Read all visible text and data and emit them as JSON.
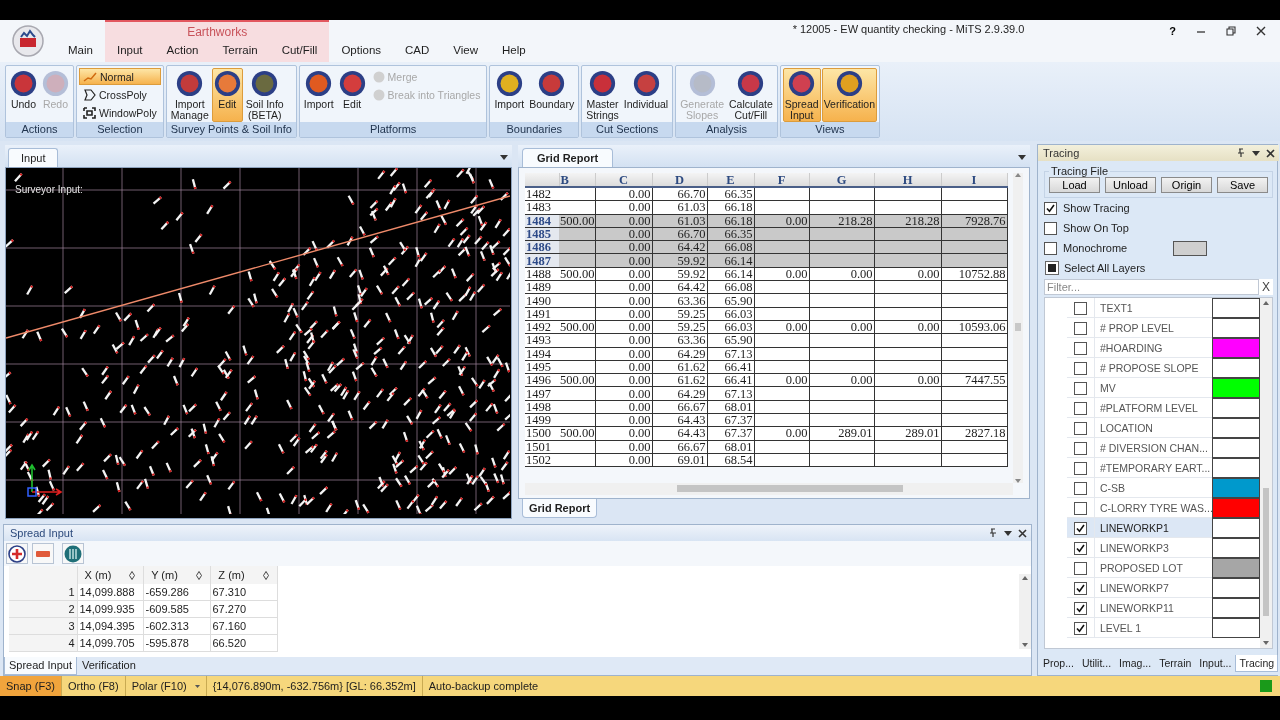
{
  "window": {
    "title": "* 12005 - EW quantity checking - MiTS 2.9.39.0",
    "help": "?"
  },
  "contextual_group": {
    "label": "Earthworks"
  },
  "menu_tabs": [
    {
      "label": "Main",
      "contextual": false
    },
    {
      "label": "Input",
      "contextual": true
    },
    {
      "label": "Action",
      "contextual": true
    },
    {
      "label": "Terrain",
      "contextual": true
    },
    {
      "label": "Cut/Fill",
      "contextual": true
    },
    {
      "label": "Options",
      "contextual": false
    },
    {
      "label": "CAD",
      "contextual": false
    },
    {
      "label": "View",
      "contextual": false
    },
    {
      "label": "Help",
      "contextual": false
    }
  ],
  "ribbon": [
    {
      "label": "Actions",
      "items": [
        {
          "kind": "large",
          "label": "Undo",
          "disabled": false,
          "active": false
        },
        {
          "kind": "large",
          "label": "Redo",
          "disabled": true,
          "active": false
        }
      ]
    },
    {
      "label": "Selection",
      "items": [
        {
          "kind": "small",
          "label": "Normal",
          "disabled": false,
          "active": true
        },
        {
          "kind": "small",
          "label": "CrossPoly",
          "disabled": false,
          "active": false
        },
        {
          "kind": "small",
          "label": "WindowPoly",
          "disabled": false,
          "active": false
        }
      ]
    },
    {
      "label": "Survey Points & Soil Info",
      "items": [
        {
          "kind": "large",
          "label": "Import\nManage",
          "disabled": false,
          "active": false
        },
        {
          "kind": "large",
          "label": "Edit",
          "disabled": false,
          "active": true
        },
        {
          "kind": "large",
          "label": "Soil Info\n(BETA)",
          "disabled": false,
          "active": false
        }
      ]
    },
    {
      "label": "Platforms",
      "items": [
        {
          "kind": "large",
          "label": "Import",
          "disabled": false,
          "active": false
        },
        {
          "kind": "large",
          "label": "Edit",
          "disabled": false,
          "active": false
        },
        {
          "kind": "small",
          "label": "Merge",
          "disabled": true,
          "active": false
        },
        {
          "kind": "small",
          "label": "Break into Triangles",
          "disabled": true,
          "active": false
        }
      ]
    },
    {
      "label": "Boundaries",
      "items": [
        {
          "kind": "large",
          "label": "Import",
          "disabled": false,
          "active": false
        },
        {
          "kind": "large",
          "label": "Boundary",
          "disabled": false,
          "active": false
        }
      ]
    },
    {
      "label": "Cut Sections",
      "items": [
        {
          "kind": "large",
          "label": "Master\nStrings",
          "disabled": false,
          "active": false
        },
        {
          "kind": "large",
          "label": "Individual",
          "disabled": false,
          "active": false
        }
      ]
    },
    {
      "label": "Analysis",
      "items": [
        {
          "kind": "large",
          "label": "Generate\nSlopes",
          "disabled": true,
          "active": false
        },
        {
          "kind": "large",
          "label": "Calculate\nCut/Fill",
          "disabled": false,
          "active": false
        }
      ]
    },
    {
      "label": "Views",
      "items": [
        {
          "kind": "large",
          "label": "Spread\nInput",
          "disabled": false,
          "active": true
        },
        {
          "kind": "large",
          "label": "Verification",
          "disabled": false,
          "active": true
        }
      ]
    }
  ],
  "input_view": {
    "tab": "Input",
    "overlay_label": "Surveyor Input:"
  },
  "grid_report": {
    "tab": "Grid Report",
    "columns": [
      "B",
      "C",
      "D",
      "E",
      "F",
      "G",
      "H",
      "I"
    ],
    "rows": [
      {
        "header": "1482",
        "selected": false,
        "cells": [
          null,
          "0.00",
          "66.70",
          "66.35",
          null,
          null,
          null,
          null
        ]
      },
      {
        "header": "1483",
        "selected": false,
        "cells": [
          null,
          "0.00",
          "61.03",
          "66.18",
          null,
          null,
          null,
          null
        ]
      },
      {
        "header": "1484",
        "selected": true,
        "cells": [
          "500.00",
          "0.00",
          "61.03",
          "66.18",
          "0.00",
          "218.28",
          "218.28",
          "7928.76"
        ]
      },
      {
        "header": "1485",
        "selected": true,
        "cells": [
          null,
          "0.00",
          "66.70",
          "66.35",
          null,
          null,
          null,
          null
        ]
      },
      {
        "header": "1486",
        "selected": true,
        "cells": [
          null,
          "0.00",
          "64.42",
          "66.08",
          null,
          null,
          null,
          null
        ]
      },
      {
        "header": "1487",
        "selected": true,
        "cells": [
          null,
          "0.00",
          "59.92",
          "66.14",
          null,
          null,
          null,
          null
        ]
      },
      {
        "header": "1488",
        "selected": false,
        "cells": [
          "500.00",
          "0.00",
          "59.92",
          "66.14",
          "0.00",
          "0.00",
          "0.00",
          "10752.88"
        ]
      },
      {
        "header": "1489",
        "selected": false,
        "cells": [
          null,
          "0.00",
          "64.42",
          "66.08",
          null,
          null,
          null,
          null
        ]
      },
      {
        "header": "1490",
        "selected": false,
        "cells": [
          null,
          "0.00",
          "63.36",
          "65.90",
          null,
          null,
          null,
          null
        ]
      },
      {
        "header": "1491",
        "selected": false,
        "cells": [
          null,
          "0.00",
          "59.25",
          "66.03",
          null,
          null,
          null,
          null
        ]
      },
      {
        "header": "1492",
        "selected": false,
        "cells": [
          "500.00",
          "0.00",
          "59.25",
          "66.03",
          "0.00",
          "0.00",
          "0.00",
          "10593.06"
        ]
      },
      {
        "header": "1493",
        "selected": false,
        "cells": [
          null,
          "0.00",
          "63.36",
          "65.90",
          null,
          null,
          null,
          null
        ]
      },
      {
        "header": "1494",
        "selected": false,
        "cells": [
          null,
          "0.00",
          "64.29",
          "67.13",
          null,
          null,
          null,
          null
        ]
      },
      {
        "header": "1495",
        "selected": false,
        "cells": [
          null,
          "0.00",
          "61.62",
          "66.41",
          null,
          null,
          null,
          null
        ]
      },
      {
        "header": "1496",
        "selected": false,
        "cells": [
          "500.00",
          "0.00",
          "61.62",
          "66.41",
          "0.00",
          "0.00",
          "0.00",
          "7447.55"
        ]
      },
      {
        "header": "1497",
        "selected": false,
        "cells": [
          null,
          "0.00",
          "64.29",
          "67.13",
          null,
          null,
          null,
          null
        ]
      },
      {
        "header": "1498",
        "selected": false,
        "cells": [
          null,
          "0.00",
          "66.67",
          "68.01",
          null,
          null,
          null,
          null
        ]
      },
      {
        "header": "1499",
        "selected": false,
        "cells": [
          null,
          "0.00",
          "64.43",
          "67.37",
          null,
          null,
          null,
          null
        ]
      },
      {
        "header": "1500",
        "selected": false,
        "cells": [
          "500.00",
          "0.00",
          "64.43",
          "67.37",
          "0.00",
          "289.01",
          "289.01",
          "2827.18"
        ]
      },
      {
        "header": "1501",
        "selected": false,
        "cells": [
          null,
          "0.00",
          "66.67",
          "68.01",
          null,
          null,
          null,
          null
        ]
      },
      {
        "header": "1502",
        "selected": false,
        "cells": [
          null,
          "0.00",
          "69.01",
          "68.54",
          null,
          null,
          null,
          null
        ]
      }
    ],
    "bottom_tab": "Grid Report"
  },
  "tracing": {
    "title": "Tracing",
    "file_group": {
      "label": "Tracing File",
      "buttons": [
        "Load",
        "Unload",
        "Origin",
        "Save"
      ]
    },
    "options": [
      {
        "label": "Show Tracing",
        "checked": true
      },
      {
        "label": "Show On Top",
        "checked": false
      },
      {
        "label": "Monochrome",
        "checked": false,
        "color": "#cfcfcf"
      }
    ],
    "select_all": {
      "label": "Select All Layers",
      "indeterminate": true
    },
    "filter": {
      "placeholder": "Filter...",
      "clear": "X"
    },
    "layers": [
      {
        "name": "TEXT1",
        "checked": false,
        "selected": false,
        "color": "#ffffff"
      },
      {
        "name": "# PROP LEVEL",
        "checked": false,
        "selected": false,
        "color": "#ffffff"
      },
      {
        "name": "#HOARDING",
        "checked": false,
        "selected": false,
        "color": "#ff00ff"
      },
      {
        "name": "# PROPOSE  SLOPE",
        "checked": false,
        "selected": false,
        "color": "#ffffff"
      },
      {
        "name": "MV",
        "checked": false,
        "selected": false,
        "color": "#00ff00"
      },
      {
        "name": "#PLATFORM LEVEL",
        "checked": false,
        "selected": false,
        "color": "#ffffff"
      },
      {
        "name": "LOCATION",
        "checked": false,
        "selected": false,
        "color": "#ffffff"
      },
      {
        "name": "# DIVERSION CHAN...",
        "checked": false,
        "selected": false,
        "color": "#ffffff"
      },
      {
        "name": "#TEMPORARY EART...",
        "checked": false,
        "selected": false,
        "color": "#ffffff"
      },
      {
        "name": "C-SB",
        "checked": false,
        "selected": false,
        "color": "#0099cc"
      },
      {
        "name": "C-LORRY TYRE WAS...",
        "checked": false,
        "selected": false,
        "color": "#ff0000"
      },
      {
        "name": "LINEWORKP1",
        "checked": true,
        "selected": true,
        "color": "#ffffff"
      },
      {
        "name": "LINEWORKP3",
        "checked": true,
        "selected": false,
        "color": "#ffffff"
      },
      {
        "name": "PROPOSED LOT",
        "checked": false,
        "selected": false,
        "color": "#a6a6a6"
      },
      {
        "name": "LINEWORKP7",
        "checked": true,
        "selected": false,
        "color": "#ffffff"
      },
      {
        "name": "LINEWORKP11",
        "checked": true,
        "selected": false,
        "color": "#ffffff"
      },
      {
        "name": "LEVEL 1",
        "checked": true,
        "selected": false,
        "color": "#ffffff"
      }
    ],
    "bottom_tabs": [
      {
        "label": "Prop...",
        "selected": false
      },
      {
        "label": "Utilit...",
        "selected": false
      },
      {
        "label": "Imag...",
        "selected": false
      },
      {
        "label": "Terrain",
        "selected": false
      },
      {
        "label": "Input...",
        "selected": false
      },
      {
        "label": "Tracing",
        "selected": true
      }
    ]
  },
  "spread_input": {
    "title": "Spread Input",
    "columns": [
      "X (m)",
      "Y (m)",
      "Z (m)"
    ],
    "rows": [
      {
        "index": "1",
        "cells": [
          "14,099.888",
          "-659.286",
          "67.310"
        ]
      },
      {
        "index": "2",
        "cells": [
          "14,099.935",
          "-609.585",
          "67.270"
        ]
      },
      {
        "index": "3",
        "cells": [
          "14,094.395",
          "-602.313",
          "67.160"
        ]
      },
      {
        "index": "4",
        "cells": [
          "14,099.705",
          "-595.878",
          "66.520"
        ]
      }
    ],
    "bottom_tabs": [
      {
        "label": "Spread Input",
        "selected": true
      },
      {
        "label": "Verification",
        "selected": false
      }
    ]
  },
  "status_bar": {
    "toggles": [
      {
        "label": "Snap (F3)",
        "on": true,
        "dropdown": false
      },
      {
        "label": "Ortho (F8)",
        "on": false,
        "dropdown": false
      },
      {
        "label": "Polar (F10)",
        "on": false,
        "dropdown": true
      }
    ],
    "coordinates": "{14,076.890m, -632.756m} [GL: 66.352m]",
    "message": "Auto-backup complete"
  }
}
